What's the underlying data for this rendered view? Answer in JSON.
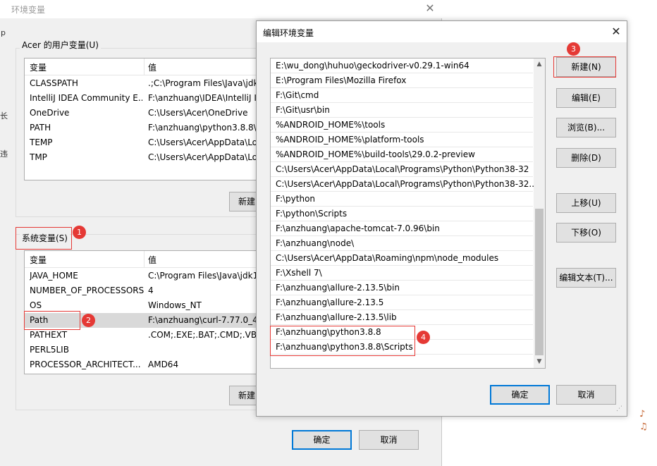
{
  "env_window": {
    "title": "环境变量",
    "user_vars": {
      "group_label": "Acer 的用户变量(U)",
      "col_name": "变量",
      "col_value": "值",
      "rows": [
        {
          "name": "CLASSPATH",
          "value": ".;C:\\Program Files\\Java\\jdk"
        },
        {
          "name": "IntelliJ IDEA Community E...",
          "value": "F:\\anzhuang\\IDEA\\IntelliJ I"
        },
        {
          "name": "OneDrive",
          "value": "C:\\Users\\Acer\\OneDrive"
        },
        {
          "name": "PATH",
          "value": "F:\\anzhuang\\python3.8.8\\S"
        },
        {
          "name": "TEMP",
          "value": "C:\\Users\\Acer\\AppData\\Loc"
        },
        {
          "name": "TMP",
          "value": "C:\\Users\\Acer\\AppData\\Loc"
        }
      ],
      "new_button": "新建"
    },
    "system_vars": {
      "group_label": "系统变量(S)",
      "col_name": "变量",
      "col_value": "值",
      "rows": [
        {
          "name": "JAVA_HOME",
          "value": "C:\\Program Files\\Java\\jdk1"
        },
        {
          "name": "NUMBER_OF_PROCESSORS",
          "value": "4"
        },
        {
          "name": "OS",
          "value": "Windows_NT"
        },
        {
          "name": "Path",
          "value": "F:\\anzhuang\\curl-7.77.0_4-"
        },
        {
          "name": "PATHEXT",
          "value": ".COM;.EXE;.BAT;.CMD;.VBS"
        },
        {
          "name": "PERL5LIB",
          "value": ""
        },
        {
          "name": "PROCESSOR_ARCHITECT...",
          "value": "AMD64"
        }
      ],
      "new_button": "新建"
    },
    "ok_button": "确定",
    "cancel_button": "取消",
    "left_edge": {
      "a": "p",
      "b": "长",
      "c": "违"
    }
  },
  "edit_dialog": {
    "title": "编辑环境变量",
    "entries": [
      "E:\\wu_dong\\huhuo\\geckodriver-v0.29.1-win64",
      "E:\\Program Files\\Mozilla Firefox",
      "F:\\Git\\cmd",
      "F:\\Git\\usr\\bin",
      "%ANDROID_HOME%\\tools",
      "%ANDROID_HOME%\\platform-tools",
      "%ANDROID_HOME%\\build-tools\\29.0.2-preview",
      "C:\\Users\\Acer\\AppData\\Local\\Programs\\Python\\Python38-32",
      "C:\\Users\\Acer\\AppData\\Local\\Programs\\Python\\Python38-32...",
      "F:\\python",
      "F:\\python\\Scripts",
      "F:\\anzhuang\\apache-tomcat-7.0.96\\bin",
      "F:\\anzhuang\\node\\",
      "C:\\Users\\Acer\\AppData\\Roaming\\npm\\node_modules",
      "F:\\Xshell 7\\",
      "F:\\anzhuang\\allure-2.13.5\\bin",
      "F:\\anzhuang\\allure-2.13.5",
      "F:\\anzhuang\\allure-2.13.5\\lib",
      "F:\\anzhuang\\python3.8.8",
      "F:\\anzhuang\\python3.8.8\\Scripts"
    ],
    "buttons": {
      "new": "新建(N)",
      "edit": "编辑(E)",
      "browse": "浏览(B)...",
      "delete": "删除(D)",
      "move_up": "上移(U)",
      "move_down": "下移(O)",
      "edit_text": "编辑文本(T)...",
      "ok": "确定",
      "cancel": "取消"
    }
  },
  "annotations": {
    "badge1": "1",
    "badge2": "2",
    "badge3": "3",
    "badge4": "4",
    "color": "#e53935"
  }
}
